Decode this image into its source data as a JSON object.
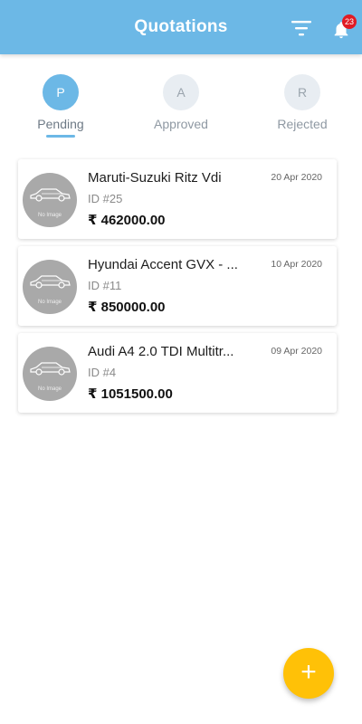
{
  "appbar": {
    "title": "Quotations",
    "notification_count": "23",
    "filter_icon": "filter-icon",
    "bell_icon": "bell-icon",
    "color": "#6cb8e6"
  },
  "tabs": [
    {
      "letter": "P",
      "label": "Pending",
      "active": true
    },
    {
      "letter": "A",
      "label": "Approved",
      "active": false
    },
    {
      "letter": "R",
      "label": "Rejected",
      "active": false
    }
  ],
  "quotations": [
    {
      "name": "Maruti-Suzuki Ritz Vdi",
      "date": "20 Apr 2020",
      "id": "ID #25",
      "price": "₹ 462000.00",
      "image_text": "No Image"
    },
    {
      "name": "Hyundai Accent GVX - ...",
      "date": "10 Apr 2020",
      "id": "ID #11",
      "price": "₹ 850000.00",
      "image_text": "No Image"
    },
    {
      "name": "Audi A4 2.0 TDI Multitr...",
      "date": "09 Apr 2020",
      "id": "ID #4",
      "price": "₹ 1051500.00",
      "image_text": "No Image"
    }
  ],
  "fab": {
    "icon": "plus-icon",
    "symbol": "+",
    "color": "#ffc107"
  }
}
